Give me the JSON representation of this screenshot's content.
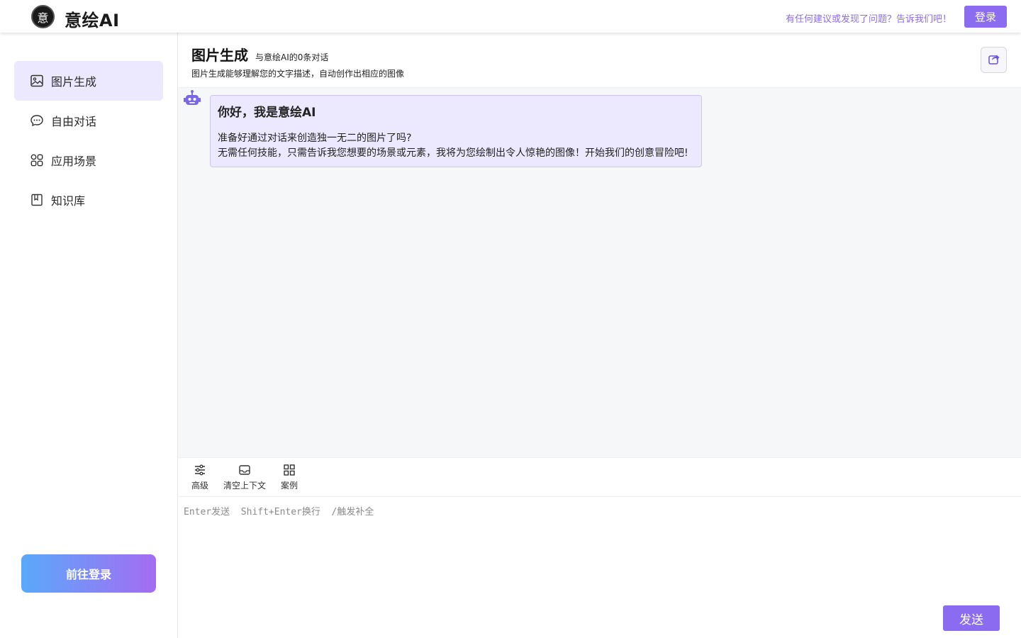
{
  "header": {
    "brand": "意绘AI",
    "logo_glyph": "意",
    "feedback": "有任何建议或发现了问题？告诉我们吧！",
    "login_label": "登录"
  },
  "sidebar": {
    "items": [
      {
        "label": "图片生成",
        "icon": "image-icon",
        "active": true
      },
      {
        "label": "自由对话",
        "icon": "chat-icon",
        "active": false
      },
      {
        "label": "应用场景",
        "icon": "grid-icon",
        "active": false
      },
      {
        "label": "知识库",
        "icon": "book-icon",
        "active": false
      }
    ],
    "goto_login": "前往登录"
  },
  "page": {
    "title": "图片生成",
    "subtitle": "与意绘AI的0条对话",
    "description": "图片生成能够理解您的文字描述，自动创作出相应的图像"
  },
  "chat": {
    "greeting_title": "你好，我是意绘AI",
    "line1": "准备好通过对话来创造独一无二的图片了吗?",
    "line2": "无需任何技能，只需告诉我您想要的场景或元素，我将为您绘制出令人惊艳的图像！开始我们的创意冒险吧!"
  },
  "toolbar": {
    "advanced": "高级",
    "clear_context": "清空上下文",
    "examples": "案例"
  },
  "input": {
    "placeholder": "Enter发送  Shift+Enter换行  /触发补全",
    "send_label": "发送"
  },
  "colors": {
    "accent": "#8b6cf0",
    "active_bg": "#ece8fd"
  }
}
